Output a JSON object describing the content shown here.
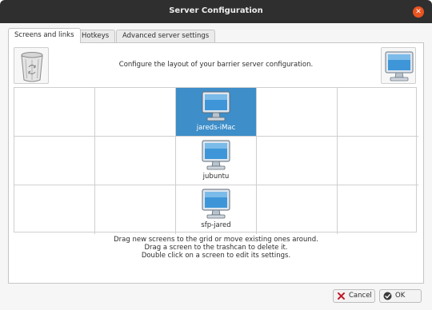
{
  "window": {
    "title": "Server Configuration",
    "close_glyph": "✕"
  },
  "tabs": [
    {
      "label": "Screens and links",
      "active": true
    },
    {
      "label": "Hotkeys",
      "active": false
    },
    {
      "label": "Advanced server settings",
      "active": false
    }
  ],
  "screens_tab": {
    "instruction_top": "Configure the layout of your barrier server configuration.",
    "trash_icon": "trash-icon",
    "new_screen_icon": "monitor-icon",
    "instructions_bottom": [
      "Drag new screens to the grid or move existing ones around.",
      "Drag a screen to the trashcan to delete it.",
      "Double click on a screen to edit its settings."
    ],
    "screens": [
      {
        "name": "jareds-iMac",
        "row": 0,
        "col": 2,
        "selected": true
      },
      {
        "name": "jubuntu",
        "row": 1,
        "col": 2,
        "selected": false
      },
      {
        "name": "sfp-jared",
        "row": 2,
        "col": 2,
        "selected": false
      }
    ]
  },
  "buttons": {
    "cancel": "Cancel",
    "ok": "OK"
  },
  "colors": {
    "selection": "#3d8ec9",
    "titlebar": "#2f2f2f",
    "close_accent": "#e95420"
  }
}
